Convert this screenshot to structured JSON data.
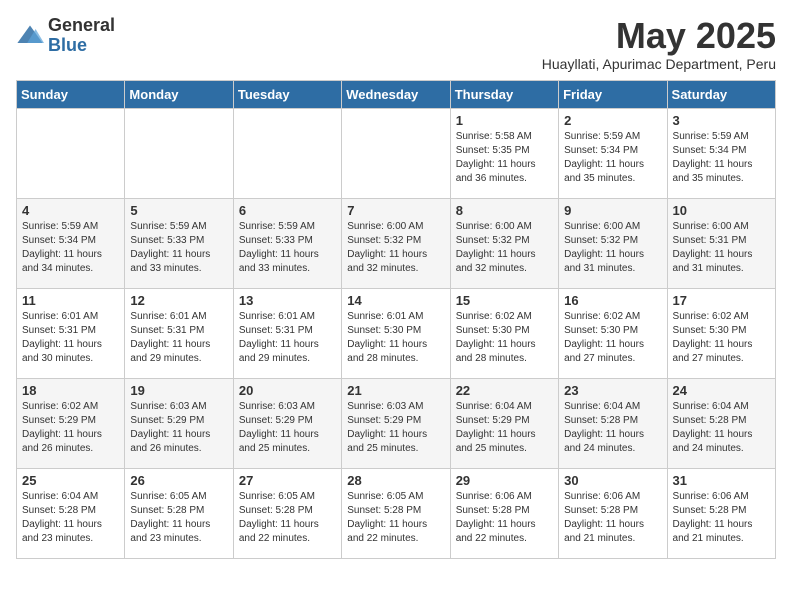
{
  "logo": {
    "general": "General",
    "blue": "Blue"
  },
  "title": "May 2025",
  "subtitle": "Huayllati, Apurimac Department, Peru",
  "days_of_week": [
    "Sunday",
    "Monday",
    "Tuesday",
    "Wednesday",
    "Thursday",
    "Friday",
    "Saturday"
  ],
  "weeks": [
    [
      {
        "day": "",
        "sunrise": "",
        "sunset": "",
        "daylight": ""
      },
      {
        "day": "",
        "sunrise": "",
        "sunset": "",
        "daylight": ""
      },
      {
        "day": "",
        "sunrise": "",
        "sunset": "",
        "daylight": ""
      },
      {
        "day": "",
        "sunrise": "",
        "sunset": "",
        "daylight": ""
      },
      {
        "day": "1",
        "sunrise": "5:58 AM",
        "sunset": "5:35 PM",
        "daylight": "11 hours and 36 minutes."
      },
      {
        "day": "2",
        "sunrise": "5:59 AM",
        "sunset": "5:34 PM",
        "daylight": "11 hours and 35 minutes."
      },
      {
        "day": "3",
        "sunrise": "5:59 AM",
        "sunset": "5:34 PM",
        "daylight": "11 hours and 35 minutes."
      }
    ],
    [
      {
        "day": "4",
        "sunrise": "5:59 AM",
        "sunset": "5:34 PM",
        "daylight": "11 hours and 34 minutes."
      },
      {
        "day": "5",
        "sunrise": "5:59 AM",
        "sunset": "5:33 PM",
        "daylight": "11 hours and 33 minutes."
      },
      {
        "day": "6",
        "sunrise": "5:59 AM",
        "sunset": "5:33 PM",
        "daylight": "11 hours and 33 minutes."
      },
      {
        "day": "7",
        "sunrise": "6:00 AM",
        "sunset": "5:32 PM",
        "daylight": "11 hours and 32 minutes."
      },
      {
        "day": "8",
        "sunrise": "6:00 AM",
        "sunset": "5:32 PM",
        "daylight": "11 hours and 32 minutes."
      },
      {
        "day": "9",
        "sunrise": "6:00 AM",
        "sunset": "5:32 PM",
        "daylight": "11 hours and 31 minutes."
      },
      {
        "day": "10",
        "sunrise": "6:00 AM",
        "sunset": "5:31 PM",
        "daylight": "11 hours and 31 minutes."
      }
    ],
    [
      {
        "day": "11",
        "sunrise": "6:01 AM",
        "sunset": "5:31 PM",
        "daylight": "11 hours and 30 minutes."
      },
      {
        "day": "12",
        "sunrise": "6:01 AM",
        "sunset": "5:31 PM",
        "daylight": "11 hours and 29 minutes."
      },
      {
        "day": "13",
        "sunrise": "6:01 AM",
        "sunset": "5:31 PM",
        "daylight": "11 hours and 29 minutes."
      },
      {
        "day": "14",
        "sunrise": "6:01 AM",
        "sunset": "5:30 PM",
        "daylight": "11 hours and 28 minutes."
      },
      {
        "day": "15",
        "sunrise": "6:02 AM",
        "sunset": "5:30 PM",
        "daylight": "11 hours and 28 minutes."
      },
      {
        "day": "16",
        "sunrise": "6:02 AM",
        "sunset": "5:30 PM",
        "daylight": "11 hours and 27 minutes."
      },
      {
        "day": "17",
        "sunrise": "6:02 AM",
        "sunset": "5:30 PM",
        "daylight": "11 hours and 27 minutes."
      }
    ],
    [
      {
        "day": "18",
        "sunrise": "6:02 AM",
        "sunset": "5:29 PM",
        "daylight": "11 hours and 26 minutes."
      },
      {
        "day": "19",
        "sunrise": "6:03 AM",
        "sunset": "5:29 PM",
        "daylight": "11 hours and 26 minutes."
      },
      {
        "day": "20",
        "sunrise": "6:03 AM",
        "sunset": "5:29 PM",
        "daylight": "11 hours and 25 minutes."
      },
      {
        "day": "21",
        "sunrise": "6:03 AM",
        "sunset": "5:29 PM",
        "daylight": "11 hours and 25 minutes."
      },
      {
        "day": "22",
        "sunrise": "6:04 AM",
        "sunset": "5:29 PM",
        "daylight": "11 hours and 25 minutes."
      },
      {
        "day": "23",
        "sunrise": "6:04 AM",
        "sunset": "5:28 PM",
        "daylight": "11 hours and 24 minutes."
      },
      {
        "day": "24",
        "sunrise": "6:04 AM",
        "sunset": "5:28 PM",
        "daylight": "11 hours and 24 minutes."
      }
    ],
    [
      {
        "day": "25",
        "sunrise": "6:04 AM",
        "sunset": "5:28 PM",
        "daylight": "11 hours and 23 minutes."
      },
      {
        "day": "26",
        "sunrise": "6:05 AM",
        "sunset": "5:28 PM",
        "daylight": "11 hours and 23 minutes."
      },
      {
        "day": "27",
        "sunrise": "6:05 AM",
        "sunset": "5:28 PM",
        "daylight": "11 hours and 22 minutes."
      },
      {
        "day": "28",
        "sunrise": "6:05 AM",
        "sunset": "5:28 PM",
        "daylight": "11 hours and 22 minutes."
      },
      {
        "day": "29",
        "sunrise": "6:06 AM",
        "sunset": "5:28 PM",
        "daylight": "11 hours and 22 minutes."
      },
      {
        "day": "30",
        "sunrise": "6:06 AM",
        "sunset": "5:28 PM",
        "daylight": "11 hours and 21 minutes."
      },
      {
        "day": "31",
        "sunrise": "6:06 AM",
        "sunset": "5:28 PM",
        "daylight": "11 hours and 21 minutes."
      }
    ]
  ],
  "labels": {
    "sunrise": "Sunrise:",
    "sunset": "Sunset:",
    "daylight": "Daylight:"
  }
}
